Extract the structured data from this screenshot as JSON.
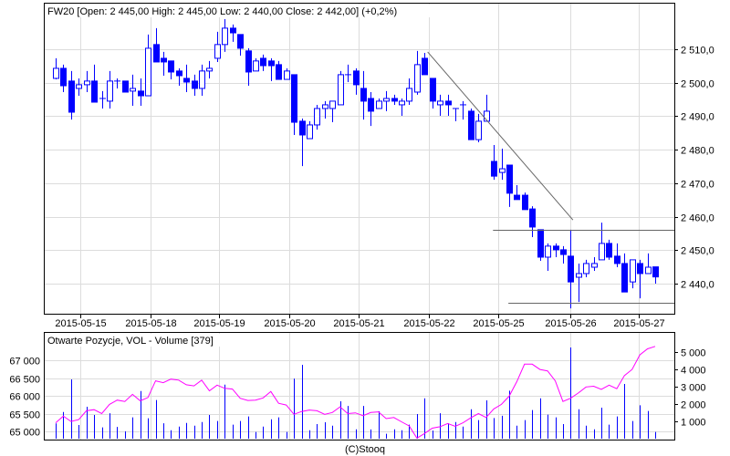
{
  "chart_data": [
    {
      "type": "candlestick",
      "title": "FW20 [Open: 2 445,00  High: 2 445,00  Low: 2 440,00  Close: 2 442,00] (+0,2%)",
      "ylim": [
        2431,
        2519
      ],
      "yticks": [
        2440,
        2450,
        2460,
        2470,
        2480,
        2490,
        2500,
        2510
      ],
      "ytick_labels": [
        "2 440,0",
        "2 450,0",
        "2 460,0",
        "2 470,0",
        "2 480,0",
        "2 490,0",
        "2 500,0",
        "2 510,0"
      ],
      "grid": true,
      "date_labels": [
        "2015-05-15",
        "2015-05-18",
        "2015-05-19",
        "2015-05-20",
        "2015-05-21",
        "2015-05-22",
        "2015-05-25",
        "2015-05-26",
        "2015-05-27"
      ],
      "date_label_bar_index": [
        3.2,
        12.3,
        21.3,
        30.4,
        39.4,
        48.6,
        57.6,
        66.9,
        75.9
      ],
      "ohlc": [
        [
          2501.3,
          2507.3,
          2501.0,
          2504.3
        ],
        [
          2504.3,
          2505.4,
          2497.2,
          2499.1
        ],
        [
          2500.5,
          2503.5,
          2489.0,
          2491.2
        ],
        [
          2498.3,
          2501.3,
          2496.1,
          2499.4
        ],
        [
          2499.4,
          2503.5,
          2497.2,
          2500.5
        ],
        [
          2500.5,
          2505.4,
          2494.2,
          2494.2
        ],
        [
          2495.3,
          2497.5,
          2492.3,
          2495.3
        ],
        [
          2494.5,
          2503.5,
          2492.3,
          2500.5
        ],
        [
          2500.5,
          2501.3,
          2498.3,
          2500.5
        ],
        [
          2500.5,
          2500.5,
          2497.2,
          2497.2
        ],
        [
          2497.5,
          2502.4,
          2493.1,
          2498.3
        ],
        [
          2497.5,
          2501.3,
          2493.1,
          2496.1
        ],
        [
          2496.1,
          2514.4,
          2496.1,
          2510.3
        ],
        [
          2511.4,
          2516.3,
          2506.2,
          2506.2
        ],
        [
          2507.3,
          2509.2,
          2502.1,
          2506.2
        ],
        [
          2506.5,
          2506.5,
          2501.0,
          2503.2
        ],
        [
          2503.5,
          2504.3,
          2499.1,
          2502.1
        ],
        [
          2501.3,
          2505.4,
          2497.2,
          2500.2
        ],
        [
          2500.5,
          2502.4,
          2496.1,
          2498.3
        ],
        [
          2498.3,
          2505.4,
          2496.1,
          2503.5
        ],
        [
          2503.5,
          2506.5,
          2501.3,
          2504.3
        ],
        [
          2507.3,
          2515.2,
          2506.2,
          2511.4
        ],
        [
          2511.4,
          2519.0,
          2509.2,
          2516.3
        ],
        [
          2516.3,
          2517.4,
          2512.2,
          2514.9
        ],
        [
          2514.4,
          2514.4,
          2508.1,
          2510.3
        ],
        [
          2509.5,
          2510.3,
          2499.1,
          2503.2
        ],
        [
          2503.5,
          2507.3,
          2503.5,
          2506.5
        ],
        [
          2507.3,
          2508.4,
          2503.5,
          2505.1
        ],
        [
          2506.5,
          2507.3,
          2500.5,
          2505.1
        ],
        [
          2505.4,
          2506.5,
          2501.0,
          2501.0
        ],
        [
          2501.0,
          2504.3,
          2501.0,
          2503.5
        ],
        [
          2502.4,
          2502.4,
          2484.4,
          2488.2
        ],
        [
          2488.5,
          2489.3,
          2475.1,
          2484.4
        ],
        [
          2483.3,
          2488.5,
          2483.3,
          2487.4
        ],
        [
          2487.4,
          2493.4,
          2486.0,
          2492.3
        ],
        [
          2492.3,
          2494.5,
          2489.3,
          2493.4
        ],
        [
          2492.3,
          2494.5,
          2488.2,
          2494.5
        ],
        [
          2493.4,
          2503.5,
          2493.4,
          2502.4
        ],
        [
          2502.4,
          2505.4,
          2500.2,
          2502.4
        ],
        [
          2503.5,
          2504.3,
          2496.4,
          2499.4
        ],
        [
          2498.3,
          2503.5,
          2489.0,
          2494.5
        ],
        [
          2495.3,
          2497.2,
          2487.1,
          2491.5
        ],
        [
          2492.3,
          2495.3,
          2492.3,
          2494.5
        ],
        [
          2494.5,
          2497.5,
          2491.5,
          2495.3
        ],
        [
          2495.3,
          2496.4,
          2493.4,
          2494.5
        ],
        [
          2493.4,
          2495.3,
          2490.1,
          2494.5
        ],
        [
          2494.5,
          2501.3,
          2493.4,
          2498.3
        ],
        [
          2497.2,
          2509.5,
          2496.4,
          2505.4
        ],
        [
          2507.3,
          2508.9,
          2502.4,
          2502.4
        ],
        [
          2501.3,
          2501.3,
          2492.3,
          2494.5
        ],
        [
          2493.4,
          2496.4,
          2490.1,
          2494.5
        ],
        [
          2494.5,
          2496.4,
          2490.1,
          2493.4
        ],
        [
          2492.3,
          2492.3,
          2488.5,
          2492.3
        ],
        [
          2493.4,
          2494.5,
          2489.0,
          2493.4
        ],
        [
          2491.5,
          2492.3,
          2483.0,
          2483.0
        ],
        [
          2483.0,
          2490.7,
          2482.2,
          2488.5
        ],
        [
          2488.5,
          2496.4,
          2488.5,
          2491.5
        ],
        [
          2476.5,
          2481.4,
          2471.0,
          2472.1
        ],
        [
          2473.2,
          2480.3,
          2471.0,
          2474.3
        ],
        [
          2475.4,
          2475.4,
          2462.9,
          2467.0
        ],
        [
          2466.4,
          2469.4,
          2465.1,
          2465.1
        ],
        [
          2466.4,
          2467.2,
          2462.1,
          2462.1
        ],
        [
          2462.3,
          2463.1,
          2453.9,
          2456.9
        ],
        [
          2456.1,
          2456.1,
          2446.8,
          2447.9
        ],
        [
          2447.9,
          2452.0,
          2443.8,
          2451.2
        ],
        [
          2451.2,
          2452.0,
          2447.9,
          2450.1
        ],
        [
          2450.1,
          2451.2,
          2446.0,
          2448.7
        ],
        [
          2448.2,
          2456.1,
          2432.6,
          2440.5
        ],
        [
          2441.9,
          2446.0,
          2434.5,
          2443.0
        ],
        [
          2443.0,
          2447.1,
          2441.9,
          2446.0
        ],
        [
          2444.9,
          2447.9,
          2443.8,
          2446.0
        ],
        [
          2447.1,
          2458.2,
          2447.1,
          2452.0
        ],
        [
          2452.0,
          2453.1,
          2447.1,
          2447.9
        ],
        [
          2448.2,
          2452.0,
          2444.9,
          2446.0
        ],
        [
          2446.0,
          2449.0,
          2437.5,
          2437.5
        ],
        [
          2440.5,
          2447.1,
          2438.6,
          2447.1
        ],
        [
          2446.0,
          2447.1,
          2435.6,
          2443.0
        ],
        [
          2443.0,
          2449.0,
          2443.0,
          2444.9
        ],
        [
          2445.0,
          2445.0,
          2440.0,
          2442.0
        ]
      ],
      "trend_line": {
        "from_bar": 48.4,
        "from_price": 2509.2,
        "to_bar": 67.3,
        "to_price": 2459.0
      },
      "horizontal_lines": [
        {
          "price": 2456.1,
          "from_bar": 56.9
        },
        {
          "price": 2434.4,
          "from_bar": 58.9
        }
      ],
      "colors": {
        "candle": "#0000ff",
        "grid": "#dcdcdc",
        "trend": "#666666",
        "hline": "#666666"
      }
    },
    {
      "type": "bar+line",
      "title": "Otwarte Pozycje, VOL - Volume [379]",
      "left_axis": {
        "ylim": [
          64750,
          67600
        ],
        "ticks": [
          65000,
          65500,
          66000,
          66500,
          67000
        ],
        "tick_labels": [
          "65 000",
          "65 500",
          "66 000",
          "66 500",
          "67 000"
        ]
      },
      "right_axis": {
        "ylim": [
          0,
          5500
        ],
        "ticks": [
          1000,
          2000,
          3000,
          4000,
          5000
        ],
        "tick_labels": [
          "1 000",
          "2 000",
          "3 000",
          "4 000",
          "5 000"
        ]
      },
      "series": [
        {
          "name": "Volume",
          "axis": "right",
          "type": "bar",
          "color": "#0000ff",
          "values": [
            880,
            1540,
            3420,
            790,
            1840,
            1370,
            650,
            1470,
            680,
            420,
            1230,
            2750,
            1180,
            2230,
            890,
            490,
            700,
            910,
            750,
            960,
            1370,
            1020,
            3120,
            810,
            1020,
            1280,
            390,
            700,
            1120,
            1230,
            390,
            3470,
            4260,
            490,
            840,
            950,
            750,
            2160,
            1890,
            540,
            1890,
            530,
            1580,
            280,
            540,
            490,
            810,
            1420,
            2330,
            470,
            1470,
            890,
            960,
            700,
            1700,
            1070,
            2210,
            1190,
            1320,
            2770,
            750,
            1070,
            1650,
            2330,
            1390,
            1230,
            840,
            5260,
            1700,
            750,
            540,
            1790,
            810,
            1280,
            3160,
            1020,
            1930,
            1600,
            390
          ]
        },
        {
          "name": "Otwarte Pozycje",
          "axis": "left",
          "type": "line",
          "color": "#ff00ff",
          "values": [
            65240,
            65430,
            65280,
            65330,
            65580,
            65610,
            65500,
            65760,
            65880,
            65840,
            66040,
            65860,
            65950,
            66420,
            66370,
            66470,
            66440,
            66310,
            66280,
            66440,
            66140,
            66300,
            66210,
            66190,
            65930,
            65870,
            65880,
            65940,
            66120,
            65790,
            65740,
            65480,
            65560,
            65600,
            65580,
            65480,
            65530,
            65690,
            65500,
            65520,
            65440,
            65530,
            65550,
            65360,
            65390,
            65270,
            65150,
            64810,
            64940,
            65090,
            65130,
            65220,
            65140,
            65240,
            65380,
            65500,
            65390,
            65630,
            65760,
            65990,
            66400,
            66890,
            66890,
            66740,
            66700,
            66420,
            65840,
            65930,
            66080,
            66250,
            66270,
            66180,
            66300,
            66200,
            66570,
            66740,
            67150,
            67320,
            67390
          ]
        }
      ]
    }
  ],
  "footer": {
    "copyright": "(C)Stooq"
  }
}
